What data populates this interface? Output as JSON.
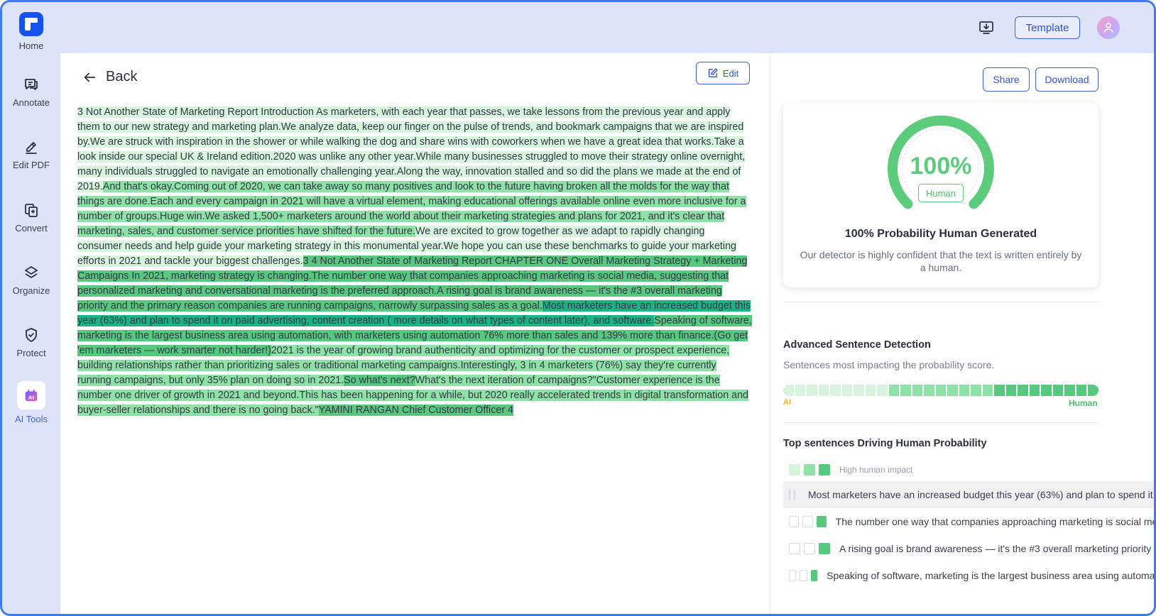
{
  "sidebar": {
    "items": [
      {
        "label": "Home",
        "icon": "home-logo"
      },
      {
        "label": "Annotate",
        "icon": "annotate-icon"
      },
      {
        "label": "Edit PDF",
        "icon": "edit-pdf-icon"
      },
      {
        "label": "Convert",
        "icon": "convert-icon"
      },
      {
        "label": "Organize",
        "icon": "organize-icon"
      },
      {
        "label": "Protect",
        "icon": "protect-icon"
      },
      {
        "label": "AI Tools",
        "icon": "ai-tools-icon"
      }
    ]
  },
  "header": {
    "template_label": "Template",
    "download_icon": "desktop-download-icon",
    "avatar_icon": "user-avatar"
  },
  "main": {
    "back_label": "Back",
    "edit_label": "Edit",
    "segments": [
      {
        "level": 1,
        "text": "3 Not Another State of Marketing Report Introduction As marketers, with each year that passes, we take lessons from the previous year and apply them to our new strategy and marketing plan.We analyze data, keep our finger on the pulse of trends, and bookmark campaigns that we are inspired by.We are struck with inspiration in the shower or while walking the dog and share wins with coworkers when we have a great idea that works.Take a look inside our special UK & Ireland edition.2020 was unlike any other year.While many businesses struggled to move their strategy online overnight, many individuals struggled to navigate an emotionally challenging year.Along the way, innovation stalled and so did the plans we made at the end of 2019."
      },
      {
        "level": 2,
        "text": "And that's okay.Coming out of 2020, we can take away so many positives and look to the future having broken all the molds for the way that things are done.Each and every campaign in 2021 will have a virtual element, making educational offerings available online even more inclusive for a number of groups.Huge win.We asked 1,500+ marketers around the world about their marketing strategies and plans for 2021, and it's clear that marketing, sales, and customer service priorities have shifted for the future."
      },
      {
        "level": 1,
        "text": "We are excited to grow together as we adapt to rapidly changing consumer needs and help guide your marketing strategy in this monumental year.We hope you can use these benchmarks to guide your marketing efforts in 2021 and tackle your biggest challenges."
      },
      {
        "level": 3,
        "text": "3 4 Not Another State of Marketing Report CHAPTER ONE Overall Marketing Strategy + Marketing Campaigns In 2021, marketing strategy is changing.The number one way that companies approaching marketing is social media, suggesting that personalized marketing and conversational marketing is the preferred approach.A rising goal is brand awareness — it's the #3 overall marketing priority and the primary reason companies are running campaigns, narrowly surpassing sales as a goal."
      },
      {
        "level": 4,
        "text": "Most marketers have an increased budget this year (63%) and plan to spend it on paid advertising, content creation ( more details on what types of content later), and software."
      },
      {
        "level": 3,
        "text": "Speaking of software, marketing is the largest business area using automation, with marketers using automation 76% more than sales and 139% more than finance.(Go get 'em marketers — work smarter not harder!)"
      },
      {
        "level": 2,
        "text": "2021 is the year of growing brand authenticity and optimizing for the customer or prospect experience, building relationships rather than prioritizing sales or traditional marketing campaigns.Interestingly, 3 in 4 marketers (76%) say they're currently running campaigns, but only 35% plan on doing so in 2021."
      },
      {
        "level": 3,
        "text": "So what's next?"
      },
      {
        "level": 2,
        "text": "What's the next iteration of campaigns?\"Customer experience is the number one driver of growth in 2021 and beyond.This has been happening for a while, but 2020 really accelerated trends in digital transformation and buyer-seller relationships and there is no going back.\""
      },
      {
        "level": 3,
        "text": "YAMINI RANGAN Chief Customer Officer 4"
      }
    ]
  },
  "right": {
    "share_label": "Share",
    "download_label": "Download",
    "score": {
      "percent_text": "100%",
      "percent_value": 100,
      "badge": "Human",
      "title": "100%  Probability Human Generated",
      "description": "Our detector is highly confident that the text is written entirely by a human."
    },
    "advanced": {
      "title": "Advanced Sentence Detection",
      "subtitle": "Sentences most impacting the probability score.",
      "meter_levels": [
        1,
        1,
        1,
        1,
        1,
        1,
        1,
        1,
        1,
        2,
        2,
        2,
        2,
        2,
        2,
        2,
        2,
        2,
        3,
        3,
        3,
        3,
        3,
        3,
        3,
        3,
        3
      ],
      "ai_label": "AI",
      "human_label": "Human"
    },
    "top": {
      "title": "Top sentences Driving Human Probability",
      "legend_label": "High human impact",
      "sentences": [
        {
          "text": "Most marketers have an increased budget this year (63%) and plan to spend it on paid advertising",
          "active": true
        },
        {
          "text": "The number one way that companies approaching marketing is social media",
          "active": false
        },
        {
          "text": "A rising goal is brand awareness — it's the #3 overall marketing priority",
          "active": false
        },
        {
          "text": "Speaking of software, marketing is the largest business area using automation",
          "active": false
        }
      ]
    }
  },
  "colors": {
    "accent": "#3d62e0",
    "human_green": "#5ccb7b",
    "hl_level_1": "#d7f4dd",
    "hl_level_2": "#8fe2a6",
    "hl_level_3": "#56c97f",
    "hl_level_4": "#19b384",
    "ai_yellow": "#f1b21c"
  }
}
